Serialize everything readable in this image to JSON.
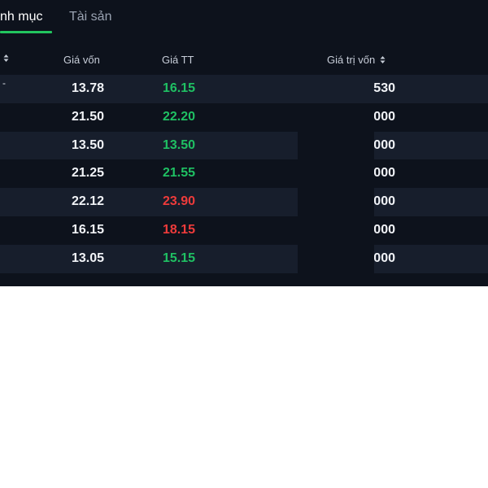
{
  "tabs": [
    {
      "label": "nh mục",
      "active": true
    },
    {
      "label": "Tài sản",
      "active": false
    }
  ],
  "header": {
    "first_col_icon": "sort-icon",
    "cost_label": "Giá vốn",
    "market_label": "Giá TT",
    "value_label": "Giá trị vốn",
    "value_icon": "sort-icon"
  },
  "rows": [
    {
      "first": "-",
      "cost": "13.78",
      "market": "16.15",
      "trend": "up",
      "value": "530"
    },
    {
      "first": "",
      "cost": "21.50",
      "market": "22.20",
      "trend": "up",
      "value": "000"
    },
    {
      "first": "",
      "cost": "13.50",
      "market": "13.50",
      "trend": "up",
      "value": "000"
    },
    {
      "first": "",
      "cost": "21.25",
      "market": "21.55",
      "trend": "up",
      "value": "000"
    },
    {
      "first": "",
      "cost": "22.12",
      "market": "23.90",
      "trend": "down",
      "value": "000"
    },
    {
      "first": "",
      "cost": "16.15",
      "market": "18.15",
      "trend": "down",
      "value": "000"
    },
    {
      "first": "",
      "cost": "13.05",
      "market": "15.15",
      "trend": "up",
      "value": "000"
    }
  ],
  "colors": {
    "background": "#0d121c",
    "row_alt": "#171e2c",
    "up": "#1fc063",
    "down": "#ef3b3b",
    "accent": "#22c55e"
  }
}
